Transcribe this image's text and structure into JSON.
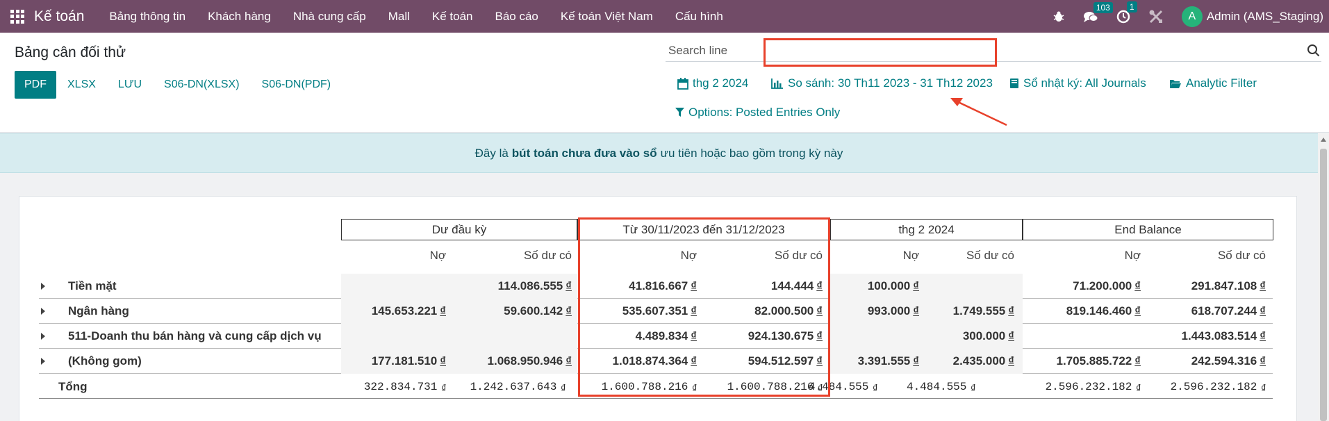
{
  "navbar": {
    "brand": "Kế toán",
    "menu": [
      "Bảng thông tin",
      "Khách hàng",
      "Nhà cung cấp",
      "Mall",
      "Kế toán",
      "Báo cáo",
      "Kế toán Việt Nam",
      "Cấu hình"
    ],
    "messages_count": "103",
    "activity_count": "1",
    "avatar_letter": "A",
    "user_name": "Admin (AMS_Staging)"
  },
  "control": {
    "title": "Bảng cân đối thử",
    "buttons": [
      "PDF",
      "XLSX",
      "LƯU",
      "S06-DN(XLSX)",
      "S06-DN(PDF)"
    ],
    "search_placeholder": "Search line",
    "filters": {
      "date": "thg 2 2024",
      "compare": "So sánh: 30 Th11 2023 - 31 Th12 2023",
      "journals": "Sổ nhật ký: All Journals",
      "analytic": "Analytic Filter",
      "options": "Options: Posted Entries Only"
    }
  },
  "alert": {
    "prefix": "Đây là",
    "bold": "bút toán chưa đưa vào sổ",
    "suffix": "ưu tiên hoặc bao gồm trong kỳ này"
  },
  "report": {
    "column_groups": [
      "Dư đầu kỳ",
      "Từ 30/11/2023 đến 31/12/2023",
      "thg 2 2024",
      "End Balance"
    ],
    "sub_headers": [
      "Nợ",
      "Số dư có",
      "Nợ",
      "Số dư có",
      "Nợ",
      "Số dư có",
      "Nợ",
      "Số dư có"
    ],
    "currency": "₫",
    "rows": [
      {
        "label": "Tiền mặt",
        "values": [
          "",
          "114.086.555",
          "41.816.667",
          "144.444",
          "100.000",
          "",
          "71.200.000",
          "291.847.108"
        ]
      },
      {
        "label": "Ngân hàng",
        "values": [
          "145.653.221",
          "59.600.142",
          "535.607.351",
          "82.000.500",
          "993.000",
          "1.749.555",
          "819.146.460",
          "618.707.244"
        ]
      },
      {
        "label": "511-Doanh thu bán hàng và cung cấp dịch vụ",
        "values": [
          "",
          "",
          "4.489.834",
          "924.130.675",
          "",
          "300.000",
          "",
          "1.443.083.514"
        ]
      },
      {
        "label": "(Không gom)",
        "values": [
          "177.181.510",
          "1.068.950.946",
          "1.018.874.364",
          "594.512.597",
          "3.391.555",
          "2.435.000",
          "1.705.885.722",
          "242.594.316"
        ]
      }
    ],
    "total": {
      "label": "Tổng",
      "values": [
        "322.834.731",
        "1.242.637.643",
        "1.600.788.216",
        "1.600.788.216",
        "4.484.555",
        "4.484.555",
        "2.596.232.182",
        "2.596.232.182"
      ]
    }
  },
  "colors": {
    "navbar": "#714b67",
    "primary": "#017e84",
    "annotation": "#e8412b"
  }
}
